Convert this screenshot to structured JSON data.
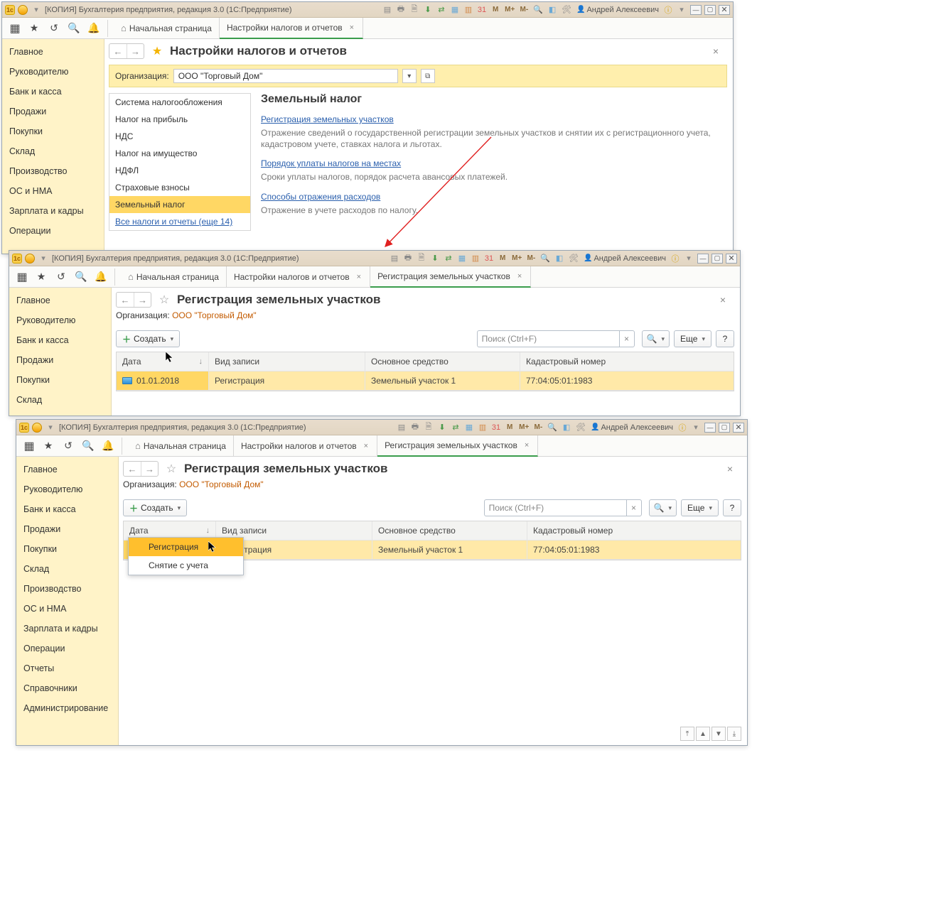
{
  "app_title": "[КОПИЯ] Бухгалтерия предприятия, редакция 3.0  (1С:Предприятие)",
  "user": "Андрей Алексеевич",
  "mbuttons": [
    "M",
    "M+",
    "M-"
  ],
  "sidebar": {
    "items": [
      "Главное",
      "Руководителю",
      "Банк и касса",
      "Продажи",
      "Покупки",
      "Склад",
      "Производство",
      "ОС и НМА",
      "Зарплата и кадры",
      "Операции",
      "Отчеты",
      "Справочники",
      "Администрирование"
    ]
  },
  "tabs": {
    "home": "Начальная страница",
    "tab1": "Настройки налогов и отчетов",
    "tab2": "Регистрация земельных участков"
  },
  "w1": {
    "page_title": "Настройки налогов и отчетов",
    "org_label": "Организация:",
    "org_value": "ООО \"Торговый Дом\"",
    "list": [
      "Система налогообложения",
      "Налог на прибыль",
      "НДС",
      "Налог на имущество",
      "НДФЛ",
      "Страховые взносы",
      "Земельный налог"
    ],
    "list_link": "Все налоги и отчеты (еще 14)",
    "pane_title": "Земельный налог",
    "link1": "Регистрация земельных участков",
    "desc1": "Отражение сведений о государственной регистрации земельных участков и снятии их с регистрационного учета, кадастровом учете, ставках налога и льготах.",
    "link2": "Порядок уплаты налогов на местах",
    "desc2": "Сроки уплаты налогов, порядок расчета авансовых платежей.",
    "link3": "Способы отражения расходов",
    "desc3": "Отражение в учете расходов по налогу."
  },
  "reg": {
    "page_title": "Регистрация земельных участков",
    "org_label": "Организация:",
    "org_value": "ООО \"Торговый Дом\"",
    "create": "Создать",
    "search_ph": "Поиск (Ctrl+F)",
    "more": "Еще",
    "cols": {
      "date": "Дата",
      "type": "Вид записи",
      "asset": "Основное средство",
      "cad": "Кадастровый номер"
    },
    "row": {
      "date": "01.01.2018",
      "type": "Регистрация",
      "asset": "Земельный участок 1",
      "cad": "77:04:05:01:1983"
    },
    "menu": {
      "reg": "Регистрация",
      "unreg": "Снятие с учета"
    }
  }
}
